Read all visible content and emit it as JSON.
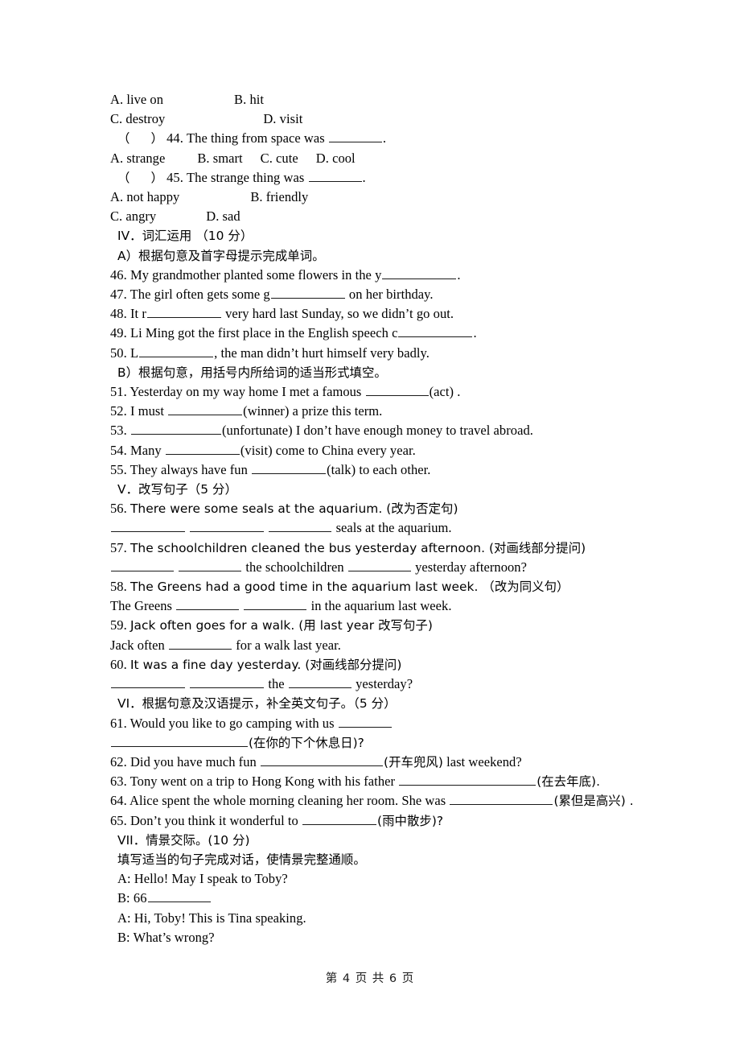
{
  "page": {
    "footer": "第 4 页 共 6 页",
    "footer_page_number": "4",
    "footer_total_pages": "6"
  },
  "mc_tail": {
    "q43_options": {
      "a": "A. live on",
      "b": "B. hit",
      "c": "C. destroy",
      "d": "D. visit"
    },
    "q44": {
      "marker_open": "（",
      "marker_close": "）",
      "stem": "44. The thing from space was",
      "period": ".",
      "a": "A. strange",
      "b": "B. smart",
      "c": "C. cute",
      "d": "D. cool"
    },
    "q45": {
      "marker_open": "（",
      "marker_close": "）",
      "stem": "45. The strange thing was",
      "period": ".",
      "a": "A. not happy",
      "b": "B. friendly",
      "c": "C. angry",
      "d": "D. sad"
    }
  },
  "section_4": {
    "heading": "IV．词汇运用 （10 分）",
    "part_a_heading": "A）根据句意及首字母提示完成单词。",
    "items_a": [
      {
        "num": "46.",
        "text_before": "My grandmother planted some flowers in the y",
        "text_after": "."
      },
      {
        "num": "47.",
        "text_before": "The girl often gets some g",
        "text_after": "on her birthday."
      },
      {
        "num": "48.",
        "text_before": "It r",
        "text_after": "very hard last Sunday, so we didn’t go out."
      },
      {
        "num": "49.",
        "text_before": "Li Ming got the first place in the English speech c",
        "text_after": "."
      },
      {
        "num": "50.",
        "text_before": "L",
        "text_after": ", the man didn’t hurt himself very badly."
      }
    ],
    "part_b_heading": "B）根据句意，用括号内所给词的适当形式填空。",
    "items_b": [
      {
        "num": "51.",
        "text_before": "Yesterday on my way home I met a famous",
        "text_after": "(act) ."
      },
      {
        "num": "52.",
        "text_before": "I must",
        "text_after": "(winner) a prize this term."
      },
      {
        "num": "53.",
        "text_before": "",
        "text_after": "(unfortunate) I don’t have enough money to travel abroad."
      },
      {
        "num": "54.",
        "text_before": "Many",
        "text_after": "(visit) come to China every year."
      },
      {
        "num": "55.",
        "text_before": "They always have fun",
        "text_after": "(talk) to each other."
      }
    ]
  },
  "section_5": {
    "heading": "V．改写句子（5 分）",
    "items": [
      {
        "num": "56.",
        "prompt": "There were some seals at the aquarium. (改为否定句)",
        "answer_tail": "seals at the aquarium."
      },
      {
        "num": "57.",
        "prompt": "The schoolchildren cleaned the bus yesterday afternoon. (对画线部分提问)",
        "answer_mid": "the schoolchildren",
        "answer_tail": "yesterday afternoon?"
      },
      {
        "num": "58.",
        "prompt": "The Greens had a good time in the aquarium last week. （改为同义句）",
        "answer_head": "The Greens",
        "answer_tail": "in the aquarium last week."
      },
      {
        "num": "59.",
        "prompt": "Jack often goes for a walk. (用 last year 改写句子)",
        "answer_head": "Jack often",
        "answer_tail": "for a walk last year."
      },
      {
        "num": "60.",
        "prompt": "It was a fine day yesterday. (对画线部分提问)",
        "answer_mid": "the",
        "answer_tail": "yesterday?"
      }
    ]
  },
  "section_6": {
    "heading": "VI．根据句意及汉语提示，补全英文句子。（5 分）",
    "items": [
      {
        "num": "61.",
        "text_before": "Would you like to go camping with us",
        "hint": "(在你的下个休息日)?"
      },
      {
        "num": "62.",
        "text_before": "Did you have much fun",
        "hint": "(开车兜风)",
        "text_after": "last weekend?"
      },
      {
        "num": "63.",
        "text_before": "Tony went on a trip to Hong Kong with his father",
        "hint": "(在去年底)."
      },
      {
        "num": "64.",
        "text_before": "Alice spent the whole morning cleaning her room. She was",
        "hint": "(累但是高兴) ."
      },
      {
        "num": "65.",
        "text_before": "Don’t you think it wonderful to",
        "hint": "(雨中散步)?"
      }
    ]
  },
  "section_7": {
    "heading": "VII．情景交际。(10 分)",
    "instruction": "填写适当的句子完成对话，使情景完整通顺。",
    "dialogue": [
      {
        "speaker": "A:",
        "text": "Hello! May I speak to Toby?"
      },
      {
        "speaker": "B:",
        "text": "66",
        "has_blank": true
      },
      {
        "speaker": "A:",
        "text": "Hi, Toby! This is Tina speaking."
      },
      {
        "speaker": "B:",
        "text": "What’s wrong?"
      }
    ]
  }
}
